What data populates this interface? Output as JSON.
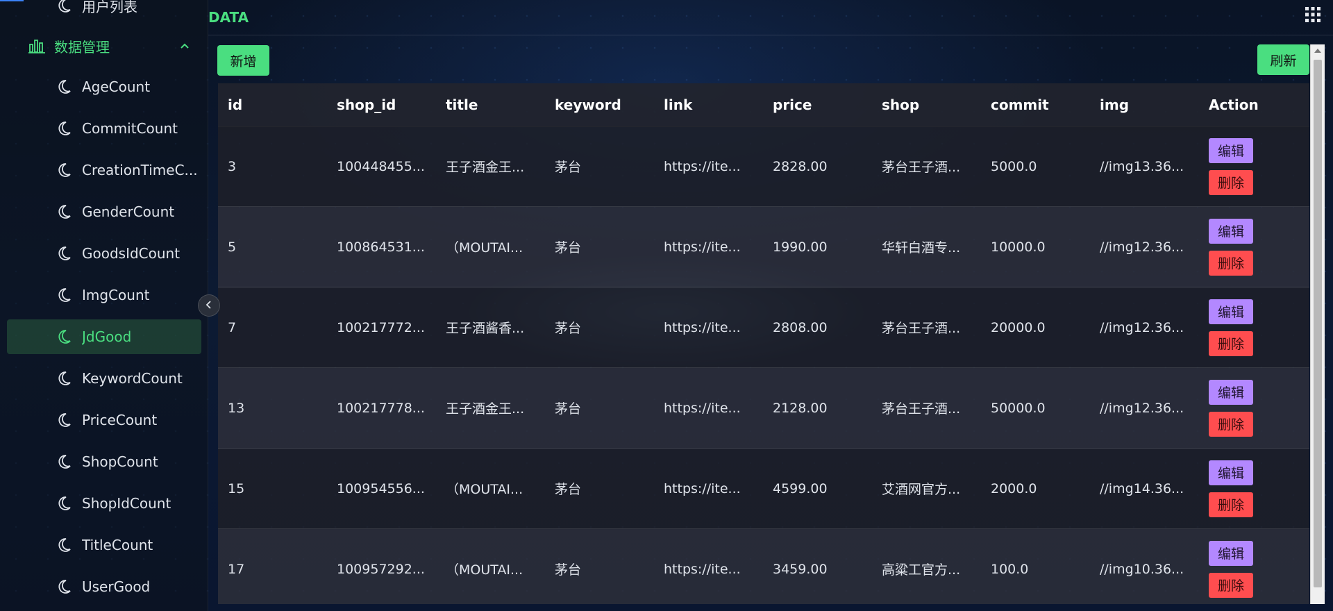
{
  "app": {
    "brand": "DATA"
  },
  "sidebar": {
    "partial_item": "用户列表",
    "group": {
      "label": "数据管理",
      "expanded": true
    },
    "items": [
      {
        "label": "AgeCount"
      },
      {
        "label": "CommitCount"
      },
      {
        "label": "CreationTimeC..."
      },
      {
        "label": "GenderCount"
      },
      {
        "label": "GoodsIdCount"
      },
      {
        "label": "ImgCount"
      },
      {
        "label": "JdGood",
        "active": true
      },
      {
        "label": "KeywordCount"
      },
      {
        "label": "PriceCount"
      },
      {
        "label": "ShopCount"
      },
      {
        "label": "ShopIdCount"
      },
      {
        "label": "TitleCount"
      },
      {
        "label": "UserGood"
      }
    ]
  },
  "toolbar": {
    "add_label": "新增",
    "refresh_label": "刷新"
  },
  "table": {
    "columns": [
      "id",
      "shop_id",
      "title",
      "keyword",
      "link",
      "price",
      "shop",
      "commit",
      "img",
      "Action"
    ],
    "rows": [
      {
        "id": "3",
        "shop_id": "100448455...",
        "title": "王子酒金王...",
        "keyword": "茅台",
        "link": "https://ite...",
        "price": "2828.00",
        "shop": "茅台王子酒...",
        "commit": "5000.0",
        "img": "//img13.36..."
      },
      {
        "id": "5",
        "shop_id": "100864531...",
        "title": "（MOUTAI...",
        "keyword": "茅台",
        "link": "https://ite...",
        "price": "1990.00",
        "shop": "华轩白酒专...",
        "commit": "10000.0",
        "img": "//img12.36..."
      },
      {
        "id": "7",
        "shop_id": "100217772...",
        "title": "王子酒酱香...",
        "keyword": "茅台",
        "link": "https://ite...",
        "price": "2808.00",
        "shop": "茅台王子酒...",
        "commit": "20000.0",
        "img": "//img12.36..."
      },
      {
        "id": "13",
        "shop_id": "100217778...",
        "title": "王子酒金王...",
        "keyword": "茅台",
        "link": "https://ite...",
        "price": "2128.00",
        "shop": "茅台王子酒...",
        "commit": "50000.0",
        "img": "//img12.36..."
      },
      {
        "id": "15",
        "shop_id": "100954556...",
        "title": "（MOUTAI...",
        "keyword": "茅台",
        "link": "https://ite...",
        "price": "4599.00",
        "shop": "艾酒网官方...",
        "commit": "2000.0",
        "img": "//img14.36..."
      },
      {
        "id": "17",
        "shop_id": "100957292...",
        "title": "（MOUTAI...",
        "keyword": "茅台",
        "link": "https://ite...",
        "price": "3459.00",
        "shop": "高粱工官方...",
        "commit": "100.0",
        "img": "//img10.36..."
      }
    ],
    "action_labels": {
      "edit": "编辑",
      "delete": "删除"
    }
  },
  "colors": {
    "accent_green": "#4ade80",
    "edit_purple": "#b388ff",
    "delete_red": "#ff4d4f"
  }
}
